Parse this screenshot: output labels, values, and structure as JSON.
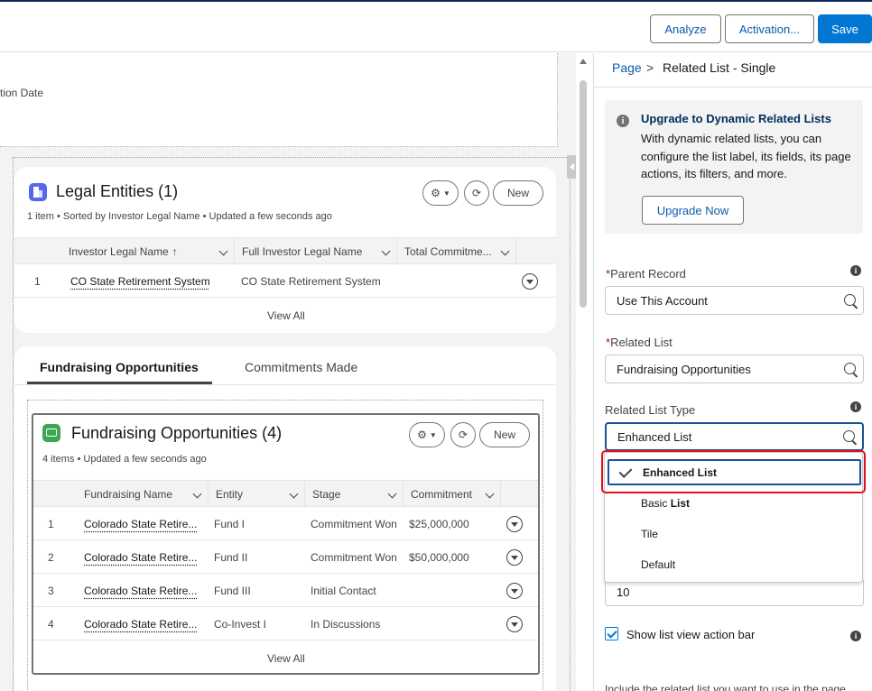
{
  "toolbar": {
    "analyze": "Analyze",
    "activation": "Activation...",
    "save": "Save"
  },
  "canvas": {
    "partial_label": "tion Date",
    "legal_entities": {
      "title": "Legal Entities (1)",
      "subtitle": "1 item • Sorted by Investor Legal Name • Updated a few seconds ago",
      "new_label": "New",
      "columns": [
        "Investor Legal Name",
        "Full Investor Legal Name",
        "Total Commitme..."
      ],
      "sort_arrow": "↑",
      "rows": [
        {
          "num": "1",
          "name": "CO State Retirement System",
          "full": "CO State Retirement System"
        }
      ],
      "view_all": "View All"
    },
    "tabs": [
      "Fundraising Opportunities",
      "Commitments Made"
    ],
    "fundraising": {
      "title": "Fundraising Opportunities (4)",
      "subtitle": "4 items • Updated a few seconds ago",
      "new_label": "New",
      "columns": [
        "Fundraising Name",
        "Entity",
        "Stage",
        "Commitment"
      ],
      "rows": [
        {
          "num": "1",
          "name": "Colorado State Retire...",
          "entity": "Fund I",
          "stage": "Commitment Won",
          "commitment": "$25,000,000"
        },
        {
          "num": "2",
          "name": "Colorado State Retire...",
          "entity": "Fund II",
          "stage": "Commitment Won",
          "commitment": "$50,000,000"
        },
        {
          "num": "3",
          "name": "Colorado State Retire...",
          "entity": "Fund III",
          "stage": "Initial Contact",
          "commitment": ""
        },
        {
          "num": "4",
          "name": "Colorado State Retire...",
          "entity": "Co-Invest I",
          "stage": "In Discussions",
          "commitment": ""
        }
      ],
      "view_all": "View All"
    }
  },
  "panel": {
    "breadcrumb": {
      "root": "Page",
      "sep": ">",
      "current": "Related List - Single"
    },
    "upgrade": {
      "title": "Upgrade to Dynamic Related Lists",
      "body": "With dynamic related lists, you can configure the list label, its fields, its page actions, its filters, and more.",
      "button": "Upgrade Now"
    },
    "parent_record": {
      "label": "Parent Record",
      "value": "Use This Account"
    },
    "related_list": {
      "label": "Related List",
      "value": "Fundraising Opportunities"
    },
    "related_list_type": {
      "label": "Related List Type",
      "value": "Enhanced List",
      "options": [
        {
          "pre": "Enhanced List",
          "bold": ""
        },
        {
          "pre": "Basic ",
          "bold": "List"
        },
        {
          "pre": "Tile",
          "bold": ""
        },
        {
          "pre": "Default",
          "bold": ""
        }
      ]
    },
    "records_value": "10",
    "show_action_bar": "Show list view action bar",
    "footer_text": "Include the related list you want to use in the page"
  },
  "colors": {
    "brand": "#0176d3",
    "highlight": "#e0101e",
    "legal_icon": "#5867e8",
    "fund_icon": "#3ba755"
  }
}
